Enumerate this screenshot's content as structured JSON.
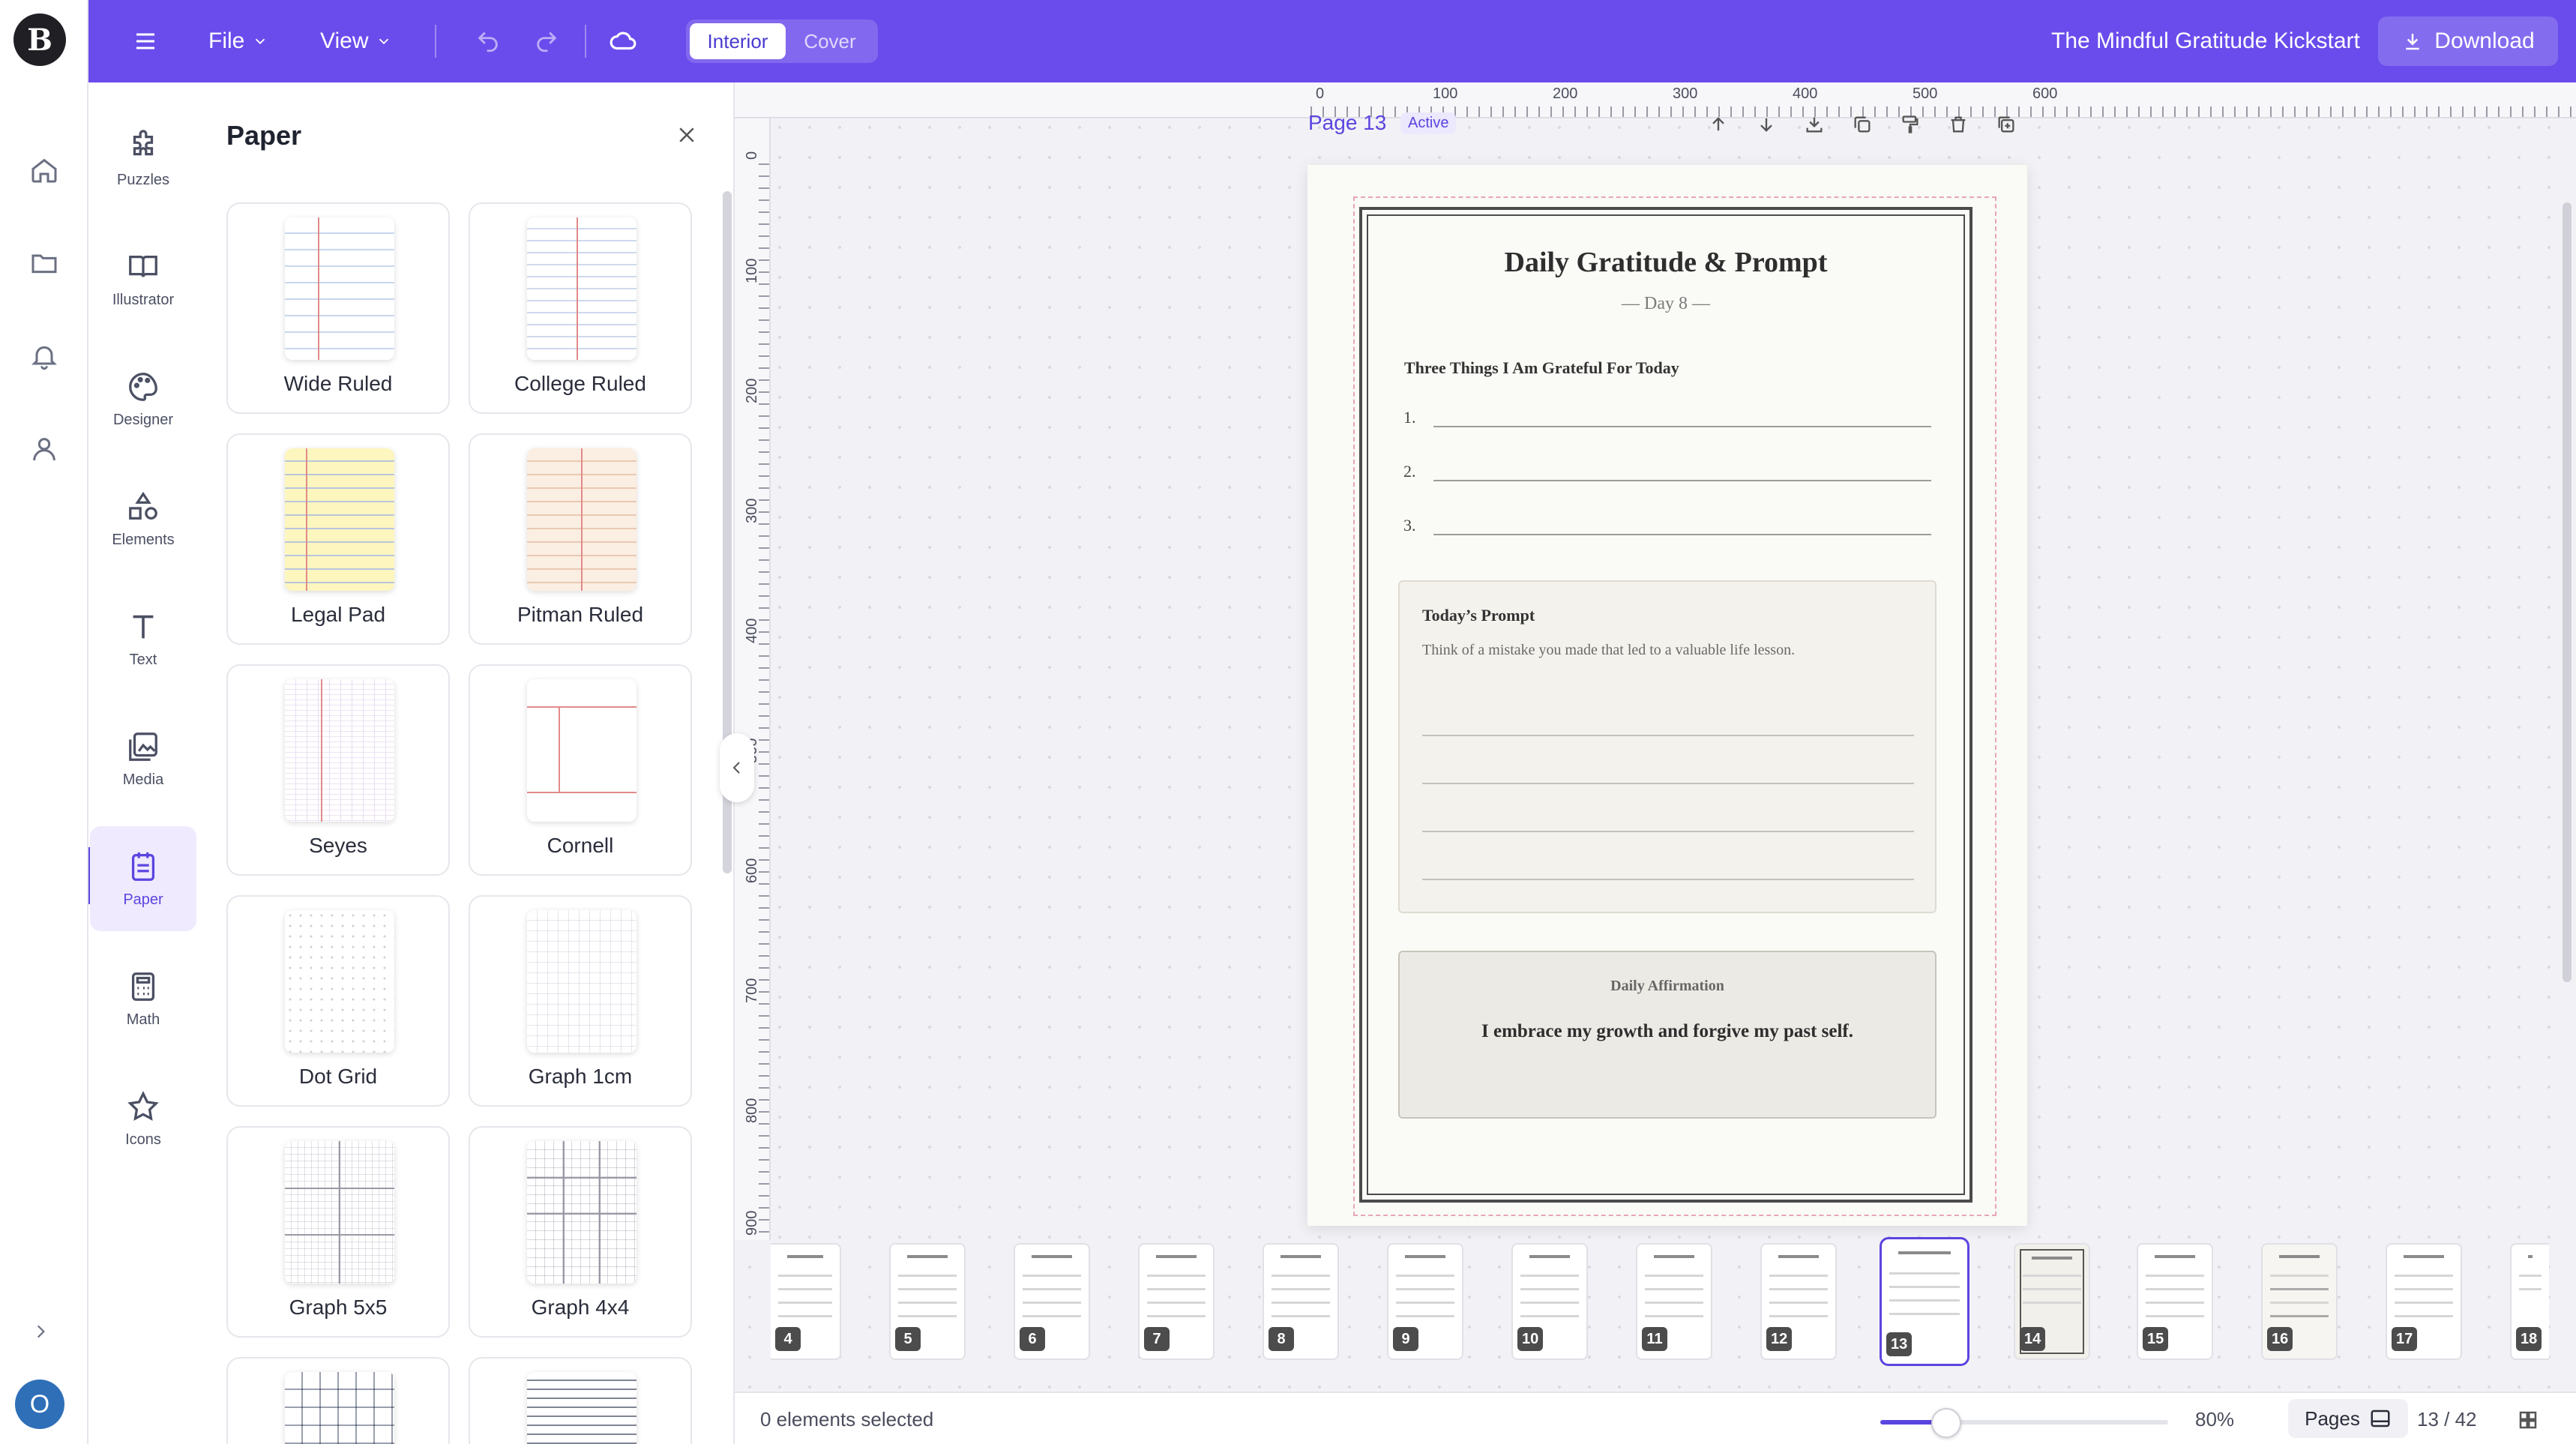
{
  "brand": {
    "logo_letter": "B"
  },
  "topbar": {
    "menu_file": "File",
    "menu_view": "View",
    "mode_interior": "Interior",
    "mode_cover": "Cover",
    "book_title": "The Mindful Gratitude Kickstart",
    "download_label": "Download",
    "accent_color": "#6a4cec"
  },
  "rail": {
    "items": [
      {
        "label": "Puzzles",
        "icon": "puzzle-icon"
      },
      {
        "label": "Illustrator",
        "icon": "book-open-icon"
      },
      {
        "label": "Designer",
        "icon": "palette-icon"
      },
      {
        "label": "Elements",
        "icon": "shapes-icon"
      },
      {
        "label": "Text",
        "icon": "text-icon"
      },
      {
        "label": "Media",
        "icon": "image-icon"
      },
      {
        "label": "Paper",
        "icon": "paper-icon",
        "active": true
      },
      {
        "label": "Math",
        "icon": "calculator-icon"
      },
      {
        "label": "Icons",
        "icon": "star-icon"
      }
    ]
  },
  "panel": {
    "title": "Paper",
    "cards": [
      "Wide Ruled",
      "College Ruled",
      "Legal Pad",
      "Pitman Ruled",
      "Seyes",
      "Cornell",
      "Dot Grid",
      "Graph 1cm",
      "Graph 5x5",
      "Graph 4x4"
    ]
  },
  "ruler": {
    "top": [
      "0",
      "100",
      "200",
      "300",
      "400",
      "500",
      "600"
    ],
    "left": [
      "0",
      "100",
      "200",
      "300",
      "400",
      "500",
      "600",
      "700",
      "800",
      "900"
    ]
  },
  "canvas": {
    "page_label": "Page 13",
    "active_badge": "Active"
  },
  "page": {
    "title": "Daily Gratitude & Prompt",
    "day": "— Day 8 —",
    "gratitude_heading": "Three Things I Am Grateful For Today",
    "numbers": [
      "1.",
      "2.",
      "3."
    ],
    "prompt_heading": "Today’s Prompt",
    "prompt_text": "Think of a mistake you made that led to a valuable life lesson.",
    "affirmation_heading": "Daily Affirmation",
    "affirmation_text": "I embrace my growth and forgive my past self."
  },
  "filmstrip": {
    "pages": [
      "4",
      "5",
      "6",
      "7",
      "8",
      "9",
      "10",
      "11",
      "12",
      "13",
      "14",
      "15",
      "16",
      "17",
      "18"
    ],
    "active": "13"
  },
  "bottombar": {
    "selection": "0 elements selected",
    "zoom": "80%",
    "zoom_fraction": 0.23,
    "pages_label": "Pages",
    "page_count": "13 / 42"
  },
  "user": {
    "avatar_letter": "O"
  }
}
